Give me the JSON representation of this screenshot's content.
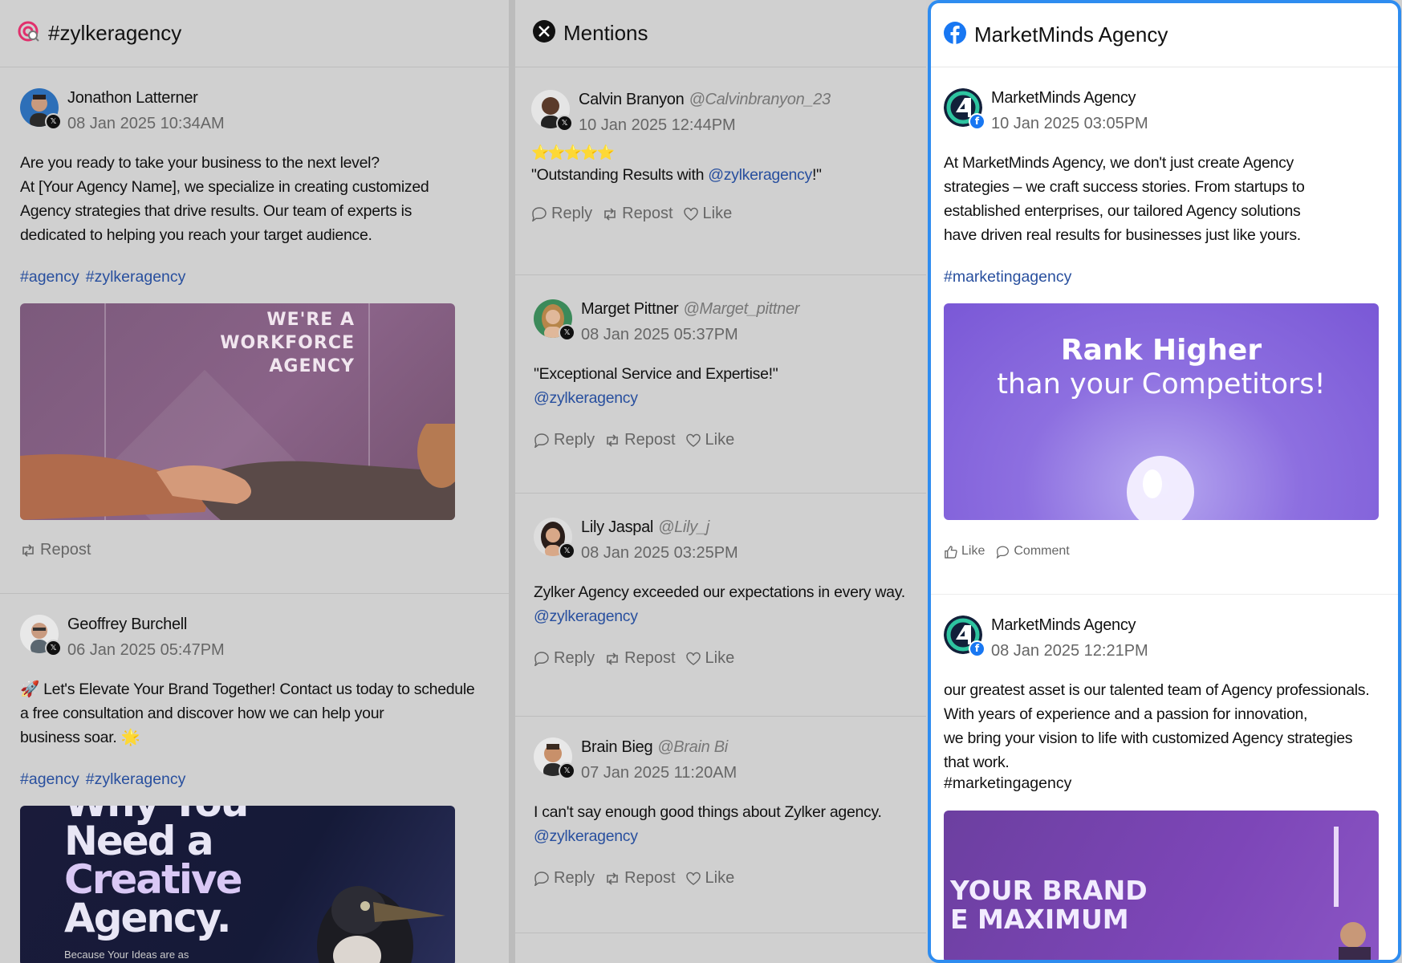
{
  "columns": {
    "hashtag": {
      "title": "#zylkeragency",
      "posts": [
        {
          "author": "Jonathon Latterner",
          "time": "08 Jan 2025 10:34AM",
          "text": "Are you ready to take your business to the next level?\nAt [Your Agency Name], we specialize in creating customized\n Agency strategies that drive results. Our team of experts is\ndedicated to helping you reach your target audience.",
          "hashtags": [
            "#agency",
            "#zylkeragency"
          ],
          "image_text": [
            "WE'RE A",
            "WORKFORCE",
            "AGENCY"
          ],
          "action": "Repost"
        },
        {
          "author": "Geoffrey Burchell",
          "time": "06 Jan 2025 05:47PM",
          "text": "🚀 Let's Elevate Your Brand Together! Contact us today to schedule\na free consultation and discover how we can help your\nbusiness soar. 🌟",
          "hashtags": [
            "#agency",
            "#zylkeragency"
          ],
          "image_text": [
            "Why You",
            "Need a",
            "Creative",
            "Agency.",
            "Because Your Ideas are as"
          ]
        }
      ]
    },
    "mentions": {
      "title": "Mentions",
      "actions": [
        "Reply",
        "Repost",
        "Like"
      ],
      "posts": [
        {
          "author": "Calvin Branyon",
          "handle": "@Calvinbranyon_23",
          "time": "10 Jan 2025 12:44PM",
          "stars": "⭐⭐⭐⭐⭐",
          "text_before": "\"Outstanding Results with ",
          "mention": "@zylkeragency",
          "text_after": "!\""
        },
        {
          "author": "Marget Pittner",
          "handle": "@Marget_pittner",
          "time": "08 Jan 2025 05:37PM",
          "text": "\"Exceptional Service and Expertise!\"",
          "mention": "@zylkeragency"
        },
        {
          "author": "Lily Jaspal",
          "handle": "@Lily_j",
          "time": "08 Jan 2025 03:25PM",
          "text": "Zylker Agency exceeded our expectations in every way.",
          "mention": "@zylkeragency"
        },
        {
          "author": "Brain Bieg",
          "handle": "@Brain Bi",
          "time": "07 Jan 2025 11:20AM",
          "text": "I can't say enough good things about Zylker agency.",
          "mention": "@zylkeragency"
        }
      ]
    },
    "facebook": {
      "title": "MarketMinds Agency",
      "actions": [
        "Like",
        "Comment"
      ],
      "posts": [
        {
          "author": "MarketMinds Agency",
          "time": "10 Jan 2025 03:05PM",
          "text": "At MarketMinds Agency, we don't just create Agency\nstrategies – we craft success stories. From startups to\nestablished enterprises, our tailored Agency solutions\nhave driven real results for businesses just like yours.",
          "hashtags": [
            "#marketingagency"
          ],
          "image_text": [
            "Rank Higher",
            "than your Competitors!"
          ]
        },
        {
          "author": "MarketMinds Agency",
          "time": "08 Jan 2025 12:21PM",
          "text": "our greatest asset is our talented team of Agency professionals.\nWith years of experience and a passion for innovation,\nwe bring your vision to life with customized Agency strategies\nthat work.",
          "hashtags": [
            "#marketingagency"
          ],
          "image_text": [
            "YOUR BRAND",
            "E MAXIMUM"
          ]
        }
      ]
    }
  },
  "colors": {
    "accent": "#2e8cf0",
    "link": "#284f9e",
    "facebook": "#1877f2",
    "instagram": "#e1306c"
  }
}
